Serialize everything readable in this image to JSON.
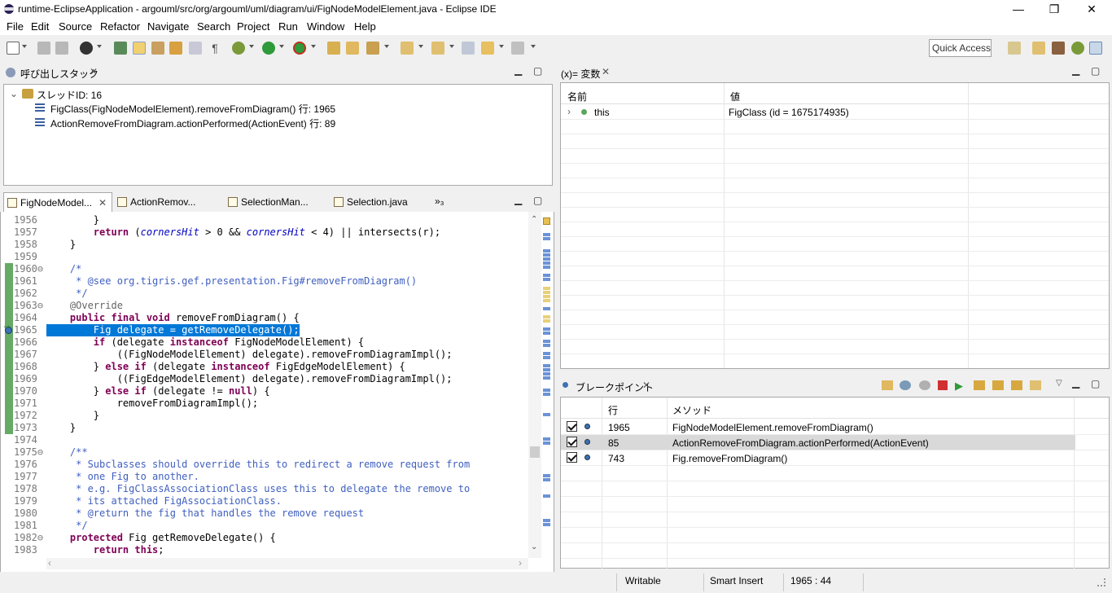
{
  "window": {
    "title": "runtime-EclipseApplication - argouml/src/org/argouml/uml/diagram/ui/FigNodeModelElement.java - Eclipse IDE",
    "controls": {
      "minimize": "—",
      "restore": "❐",
      "close": "✕"
    }
  },
  "menu": [
    "File",
    "Edit",
    "Source",
    "Refactor",
    "Navigate",
    "Search",
    "Project",
    "Run",
    "Window",
    "Help"
  ],
  "toolbar": {
    "quick_access": "Quick Access"
  },
  "callstack": {
    "title": "呼び出しスタック",
    "thread": "スレッドID: 16",
    "frames": [
      "FigClass(FigNodeModelElement).removeFromDiagram() 行: 1965",
      "ActionRemoveFromDiagram.actionPerformed(ActionEvent) 行: 89"
    ]
  },
  "variables": {
    "title": "(x)= 変数",
    "headers": {
      "name": "名前",
      "value": "値"
    },
    "rows": [
      {
        "name": "this",
        "value": "FigClass (id = 1675174935)"
      }
    ]
  },
  "editor": {
    "tabs": [
      "FigNodeModel...",
      "ActionRemov...",
      "SelectionMan...",
      "Selection.java"
    ],
    "overflow": "»₃",
    "lines": [
      {
        "n": "1956",
        "fold": "",
        "html": "        }"
      },
      {
        "n": "1957",
        "fold": "",
        "html": "        <span class=\"kw\">return</span> (<span class=\"fd\">cornersHit</span> &gt; 0 &amp;&amp; <span class=\"fd\">cornersHit</span> &lt; 4) || intersects(r);"
      },
      {
        "n": "1958",
        "fold": "",
        "html": "    }"
      },
      {
        "n": "1959",
        "fold": "",
        "html": ""
      },
      {
        "n": "1960",
        "fold": "⊖",
        "html": "    <span class=\"cm\">/*</span>"
      },
      {
        "n": "1961",
        "fold": "",
        "html": "<span class=\"cm\">     * @see org.tigris.gef.presentation.Fig#removeFromDiagram()</span>"
      },
      {
        "n": "1962",
        "fold": "",
        "html": "<span class=\"cm\">     */</span>"
      },
      {
        "n": "1963",
        "fold": "⊖",
        "html": "    <span class=\"an\">@Override</span>"
      },
      {
        "n": "1964",
        "fold": "",
        "html": "    <span class=\"kw\">public final void</span> removeFromDiagram() {"
      },
      {
        "n": "1965",
        "fold": "",
        "html": "        Fig delegate = getRemoveDelegate();",
        "hl": true
      },
      {
        "n": "1966",
        "fold": "",
        "html": "        <span class=\"kw\">if</span> (delegate <span class=\"kw\">instanceof</span> FigNodeModelElement) {"
      },
      {
        "n": "1967",
        "fold": "",
        "html": "            ((FigNodeModelElement) delegate).removeFromDiagramImpl();"
      },
      {
        "n": "1968",
        "fold": "",
        "html": "        } <span class=\"kw\">else if</span> (delegate <span class=\"kw\">instanceof</span> FigEdgeModelElement) {"
      },
      {
        "n": "1969",
        "fold": "",
        "html": "            ((FigEdgeModelElement) delegate).removeFromDiagramImpl();"
      },
      {
        "n": "1970",
        "fold": "",
        "html": "        } <span class=\"kw\">else if</span> (delegate != <span class=\"kw\">null</span>) {"
      },
      {
        "n": "1971",
        "fold": "",
        "html": "            removeFromDiagramImpl();"
      },
      {
        "n": "1972",
        "fold": "",
        "html": "        }"
      },
      {
        "n": "1973",
        "fold": "",
        "html": "    }"
      },
      {
        "n": "1974",
        "fold": "",
        "html": ""
      },
      {
        "n": "1975",
        "fold": "⊖",
        "html": "    <span class=\"cm\">/**</span>"
      },
      {
        "n": "1976",
        "fold": "",
        "html": "<span class=\"cm\">     * Subclasses should override this to redirect a remove request from</span>"
      },
      {
        "n": "1977",
        "fold": "",
        "html": "<span class=\"cm\">     * one Fig to another.</span>"
      },
      {
        "n": "1978",
        "fold": "",
        "html": "<span class=\"cm\">     * e.g. FigClassAssociationClass uses this to delegate the remove to</span>"
      },
      {
        "n": "1979",
        "fold": "",
        "html": "<span class=\"cm\">     * its attached FigAssociationClass.</span>"
      },
      {
        "n": "1980",
        "fold": "",
        "html": "<span class=\"cm\">     * @return the fig that handles the remove request</span>"
      },
      {
        "n": "1981",
        "fold": "",
        "html": "<span class=\"cm\">     */</span>"
      },
      {
        "n": "1982",
        "fold": "⊖",
        "html": "    <span class=\"kw\">protected</span> Fig getRemoveDelegate() {"
      },
      {
        "n": "1983",
        "fold": "",
        "html": "        <span class=\"kw\">return this</span>;"
      }
    ]
  },
  "breakpoints": {
    "title": "ブレークポイント",
    "headers": {
      "line": "行",
      "method": "メソッド"
    },
    "rows": [
      {
        "line": "1965",
        "method": "FigNodeModelElement.removeFromDiagram()"
      },
      {
        "line": "85",
        "method": "ActionRemoveFromDiagram.actionPerformed(ActionEvent)"
      },
      {
        "line": "743",
        "method": "Fig.removeFromDiagram()"
      }
    ]
  },
  "status": {
    "writable": "Writable",
    "insert": "Smart Insert",
    "position": "1965 : 44"
  }
}
